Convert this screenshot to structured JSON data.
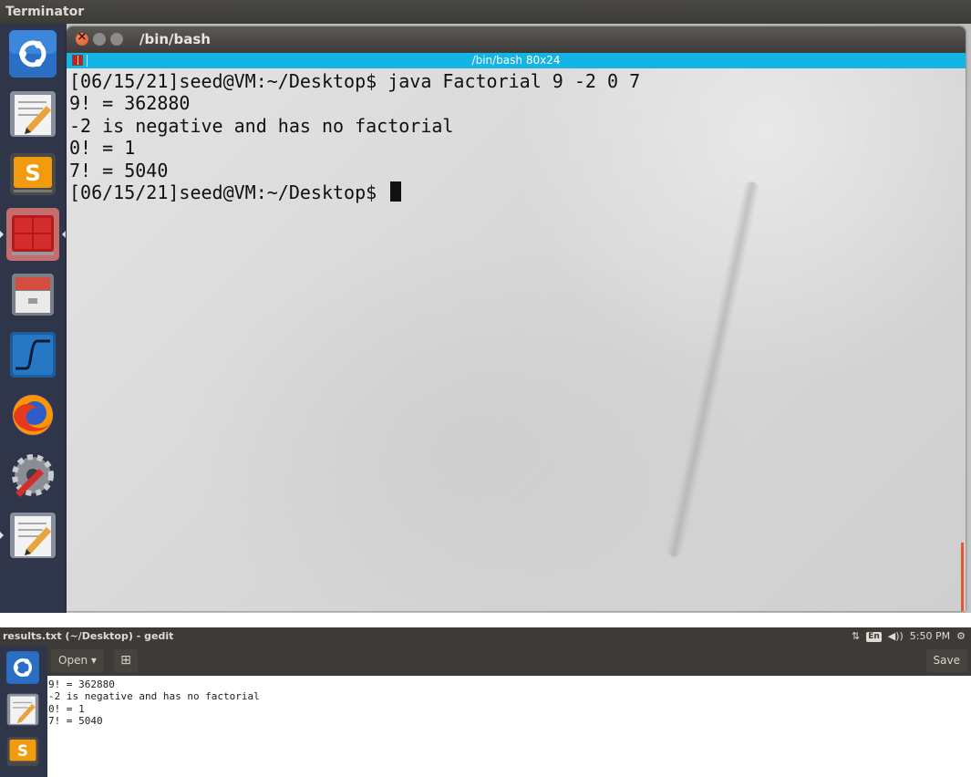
{
  "topbar": {
    "title": "Terminator"
  },
  "terminal": {
    "window_title": "/bin/bash",
    "bar_title": "/bin/bash 80x24",
    "lines": [
      "[06/15/21]seed@VM:~/Desktop$ java Factorial 9 -2 0 7",
      "9! = 362880",
      "-2 is negative and has no factorial",
      "0! = 1",
      "7! = 5040"
    ],
    "prompt": "[06/15/21]seed@VM:~/Desktop$ "
  },
  "launcher": {
    "items": [
      {
        "icon": "ubuntu-logo-icon"
      },
      {
        "icon": "text-editor-icon"
      },
      {
        "icon": "sublime-text-icon"
      },
      {
        "icon": "terminator-icon"
      },
      {
        "icon": "file-cabinet-icon"
      },
      {
        "icon": "wireshark-icon"
      },
      {
        "icon": "firefox-icon"
      },
      {
        "icon": "system-settings-icon"
      },
      {
        "icon": "text-editor-icon"
      }
    ]
  },
  "gedit": {
    "window_title": "results.txt (~/Desktop) - gedit",
    "open_label": "Open ▾",
    "new_tab_label": "⊞",
    "save_label": "Save",
    "content_lines": [
      "9! = 362880",
      "-2 is negative and has no factorial",
      "0! = 1",
      "7! = 5040"
    ]
  },
  "tray": {
    "network_glyph": "⇅",
    "keyboard_layout": "En",
    "volume_glyph": "◀))",
    "time": "5:50 PM",
    "settings_glyph": "⚙"
  },
  "colors": {
    "launcher_bg": "#30364a",
    "terminal_bar": "#14b4e4",
    "topbar_bg": "#3c3b37"
  }
}
